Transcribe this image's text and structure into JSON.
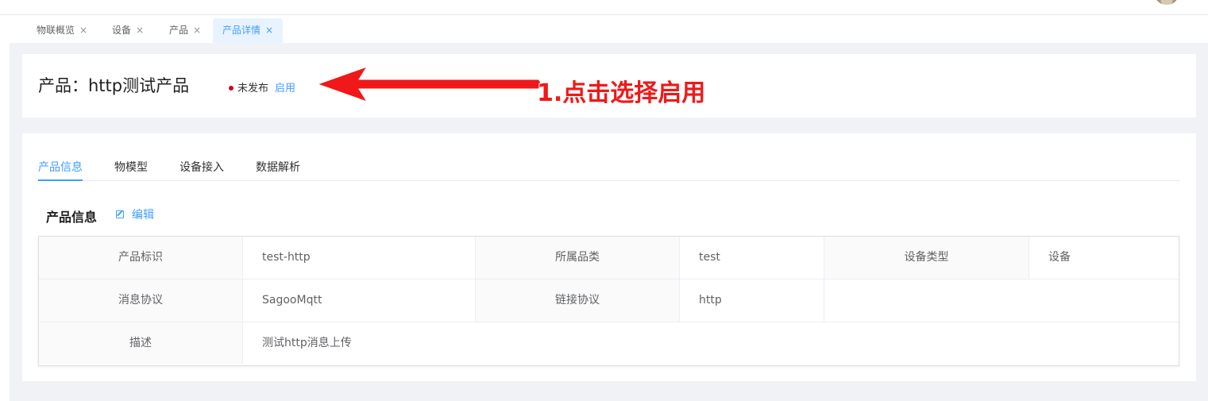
{
  "tabs": [
    {
      "label": "物联概览",
      "close": "×",
      "active": false
    },
    {
      "label": "设备",
      "close": "×",
      "active": false
    },
    {
      "label": "产品",
      "close": "×",
      "active": false
    },
    {
      "label": "产品详情",
      "close": "×",
      "active": true
    }
  ],
  "header": {
    "title": "产品：http测试产品",
    "status": "未发布",
    "status_color": "#d0021b",
    "enable_label": "启用",
    "annotation": "1.点击选择启用",
    "annotation_color": "#f01818"
  },
  "subtabs": [
    {
      "label": "产品信息",
      "active": true
    },
    {
      "label": "物模型",
      "active": false
    },
    {
      "label": "设备接入",
      "active": false
    },
    {
      "label": "数据解析",
      "active": false
    }
  ],
  "section": {
    "title": "产品信息",
    "edit_label": "编辑"
  },
  "info": {
    "rows": [
      [
        {
          "label": "产品标识",
          "value": "test-http"
        },
        {
          "label": "所属品类",
          "value": "test"
        },
        {
          "label": "设备类型",
          "value": "设备"
        }
      ],
      [
        {
          "label": "消息协议",
          "value": "SagooMqtt"
        },
        {
          "label": "链接协议",
          "value": "http"
        }
      ],
      [
        {
          "label": "描述",
          "value": "测试http消息上传"
        }
      ]
    ]
  },
  "accent_color": "#409eff"
}
